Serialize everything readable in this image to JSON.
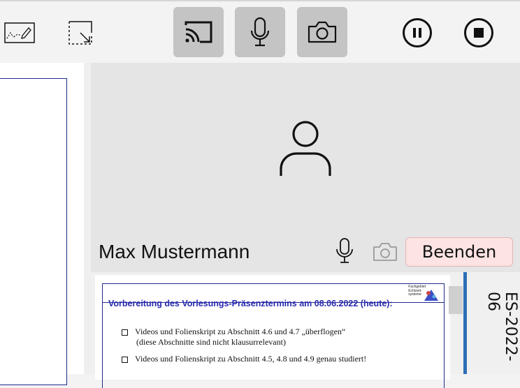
{
  "toolbar": {
    "annotate_icon": "draw-on-screen-icon",
    "region_icon": "select-region-icon",
    "cast_icon": "cast-icon",
    "mic_icon": "microphone-icon",
    "camera_icon": "camera-icon",
    "pause_icon": "pause-icon",
    "stop_icon": "stop-icon"
  },
  "participant": {
    "name": "Max Mustermann",
    "end_label": "Beenden"
  },
  "slide": {
    "dept": [
      "Fachgebiet",
      "Echtzeit-",
      "systeme"
    ],
    "title": "Vorbereitung des Vorlesungs-Präsenztermins am 08.06.2022 (heute):",
    "bullets": [
      {
        "line1": "Videos und Folienskript zu Abschnitt 4.6 und 4.7 „überflogen“",
        "line2": "(diese Abschnitte sind nicht klausurrelevant)"
      },
      {
        "line1": "Videos und Folienskript zu Abschnitt 4.5, 4.8 und 4.9 genau studiert!",
        "line2": ""
      }
    ]
  },
  "side_label": "ES-2022-06"
}
